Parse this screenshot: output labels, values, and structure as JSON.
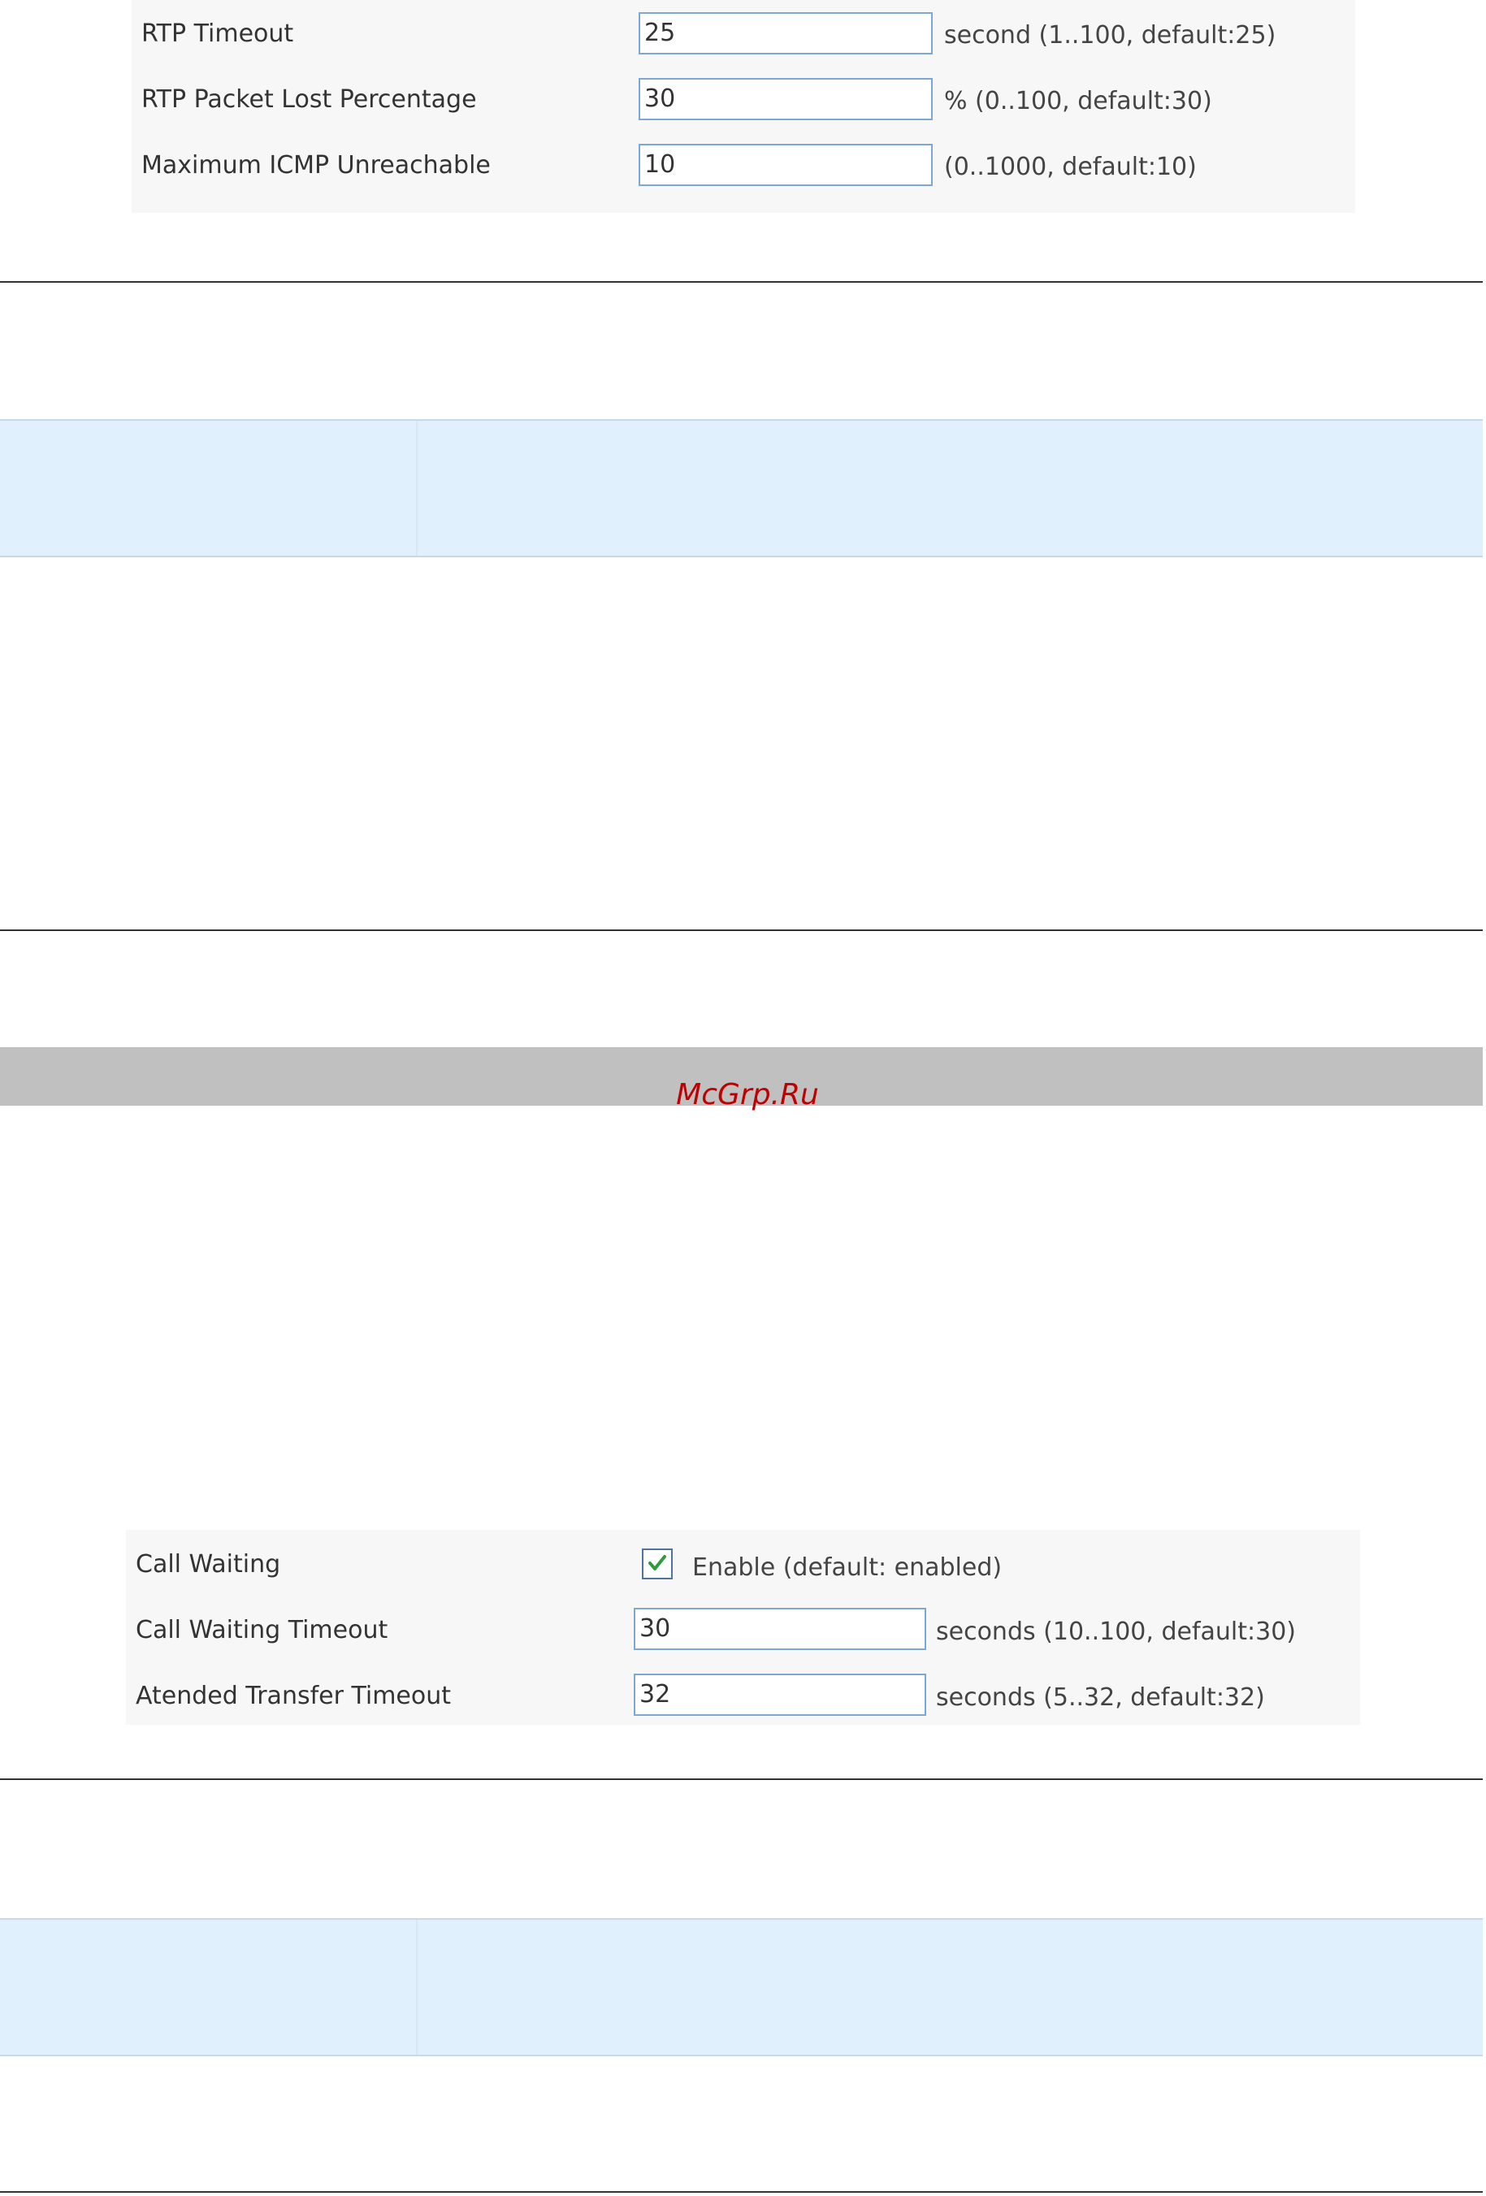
{
  "top_panel": {
    "rows": [
      {
        "label": "RTP Timeout",
        "value": "25",
        "hint": "second (1..100, default:25)"
      },
      {
        "label": "RTP Packet Lost Percentage",
        "value": "30",
        "hint": "% (0..100, default:30)"
      },
      {
        "label": "Maximum ICMP Unreachable",
        "value": "10",
        "hint": "(0..1000, default:10)"
      }
    ]
  },
  "watermark": "McGrp.Ru",
  "bottom_panel": {
    "call_waiting": {
      "label": "Call Waiting",
      "checked": true,
      "checkbox_label": "Enable (default: enabled)"
    },
    "rows": [
      {
        "label": "Call Waiting Timeout",
        "value": "30",
        "hint": "seconds (10..100, default:30)"
      },
      {
        "label": "Atended Transfer Timeout",
        "value": "32",
        "hint": "seconds (5..32, default:32)"
      }
    ]
  },
  "colors": {
    "input_border": "#7ea6d8",
    "panel_background": "#f7f7f7",
    "blue_band": "#e0f0fc",
    "gray_bar": "#c0c0c0",
    "watermark": "#c00000",
    "checkmark": "#2e9a3c"
  }
}
